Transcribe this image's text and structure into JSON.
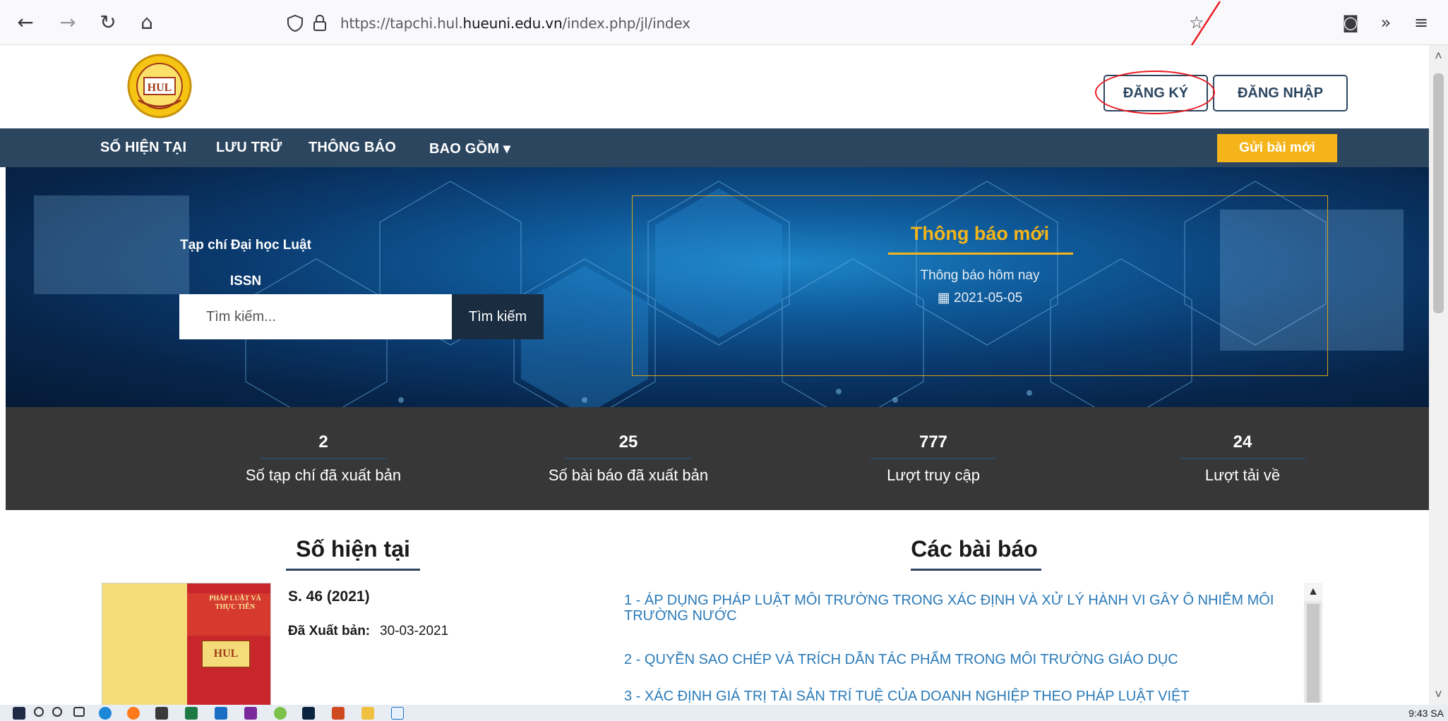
{
  "browser": {
    "url_prefix": "https://tapchi.hul.",
    "url_domain": "hueuni.edu.vn",
    "url_suffix": "/index.php/jl/index"
  },
  "header": {
    "register_label": "ĐĂNG KÝ",
    "login_label": "ĐĂNG NHẬP",
    "logo_text": "HUL"
  },
  "nav": {
    "items": [
      "SỐ HIỆN TẠI",
      "LƯU TRỮ",
      "THÔNG BÁO",
      "BAO GỒM ▾"
    ],
    "submit_label": "Gửi bài mới"
  },
  "hero": {
    "journal_title": "Tạp chí Đại học Luật",
    "issn": "ISSN",
    "search_placeholder": "Tìm kiếm...",
    "search_button": "Tìm kiếm",
    "notice_title": "Thông báo mới",
    "notice_sub": "Thông báo hôm nay",
    "notice_date": "2021-05-05"
  },
  "stats": [
    {
      "value": "2",
      "label": "Số tạp chí đã xuất bản"
    },
    {
      "value": "25",
      "label": "Số bài báo đã xuất bản"
    },
    {
      "value": "777",
      "label": "Lượt truy cập"
    },
    {
      "value": "24",
      "label": "Lượt tải về"
    }
  ],
  "current_issue": {
    "heading": "Số hiện tại",
    "title": "S. 46 (2021)",
    "published_label": "Đã Xuất bản:",
    "published_date": "30-03-2021",
    "cover_title": "PHÁP LUẬT VÀ THỰC TIỄN"
  },
  "articles": {
    "heading": "Các bài báo",
    "items": [
      "1 - ÁP DỤNG PHÁP LUẬT MÔI TRƯỜNG TRONG XÁC ĐỊNH VÀ XỬ LÝ HÀNH VI GÂY Ô NHIỄM MÔI TRƯỜNG NƯỚC",
      "2 - QUYỀN SAO CHÉP VÀ TRÍCH DẪN TÁC PHẨM TRONG MÔI TRƯỜNG GIÁO DỤC",
      "3 - XÁC ĐỊNH GIÁ TRỊ TÀI SẢN TRÍ TUỆ CỦA DOANH NGHIỆP THEO PHÁP LUẬT VIỆT"
    ]
  },
  "taskbar": {
    "time": "9:43 SA"
  },
  "colors": {
    "primary": "#2c4660",
    "accent": "#f4b41a",
    "link": "#2a7ab8",
    "stats_bg": "#373737",
    "annotation": "#e8181e"
  }
}
